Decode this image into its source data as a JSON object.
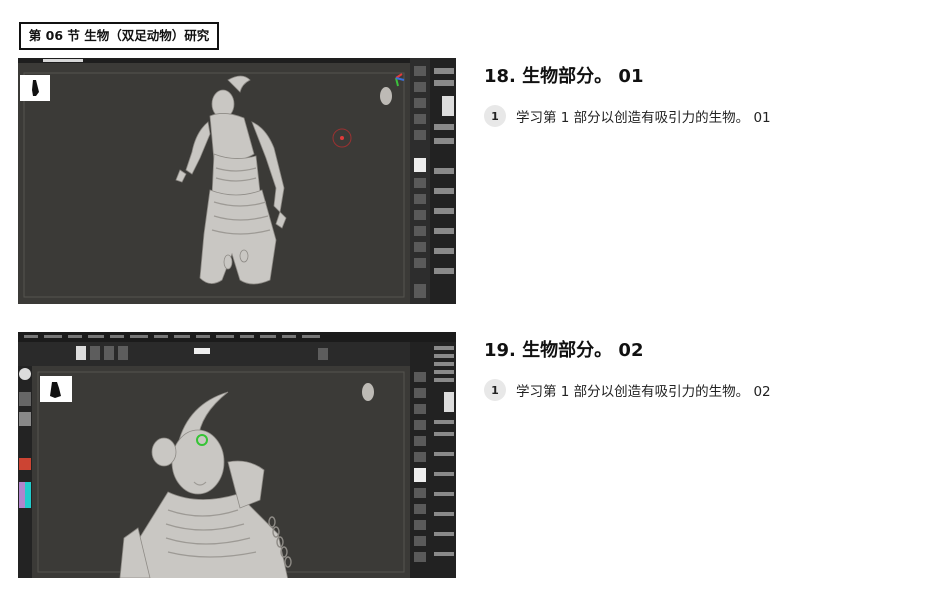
{
  "section": {
    "label": "第 06 节 生物（双足动物）研究"
  },
  "lessons": [
    {
      "title": "18. 生物部分。 01",
      "steps": [
        {
          "num": "1",
          "text": "学习第 1 部分以创造有吸引力的生物。 01"
        }
      ],
      "thumbnail": "zbrush-creature-sculpt-full-body"
    },
    {
      "title": "19. 生物部分。 02",
      "steps": [
        {
          "num": "1",
          "text": "学习第 1 部分以创造有吸引力的生物。 02"
        }
      ],
      "thumbnail": "zbrush-creature-sculpt-closeup"
    }
  ],
  "colors": {
    "viewport": "#3b3a37",
    "ui_panel": "#2a2a2a",
    "sculpt": "#c9c7c3",
    "accent_red": "#e13a3a"
  }
}
